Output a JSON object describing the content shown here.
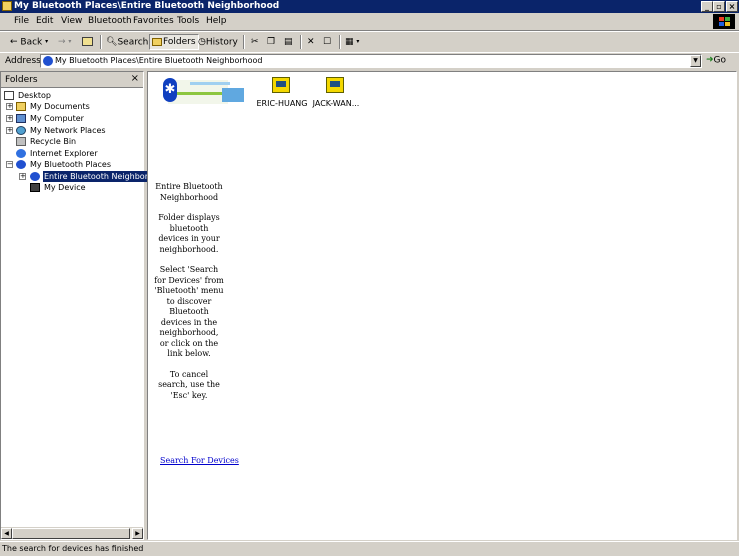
{
  "window": {
    "title": "My Bluetooth Places\\Entire Bluetooth Neighborhood"
  },
  "menu": {
    "items": [
      "File",
      "Edit",
      "View",
      "Bluetooth",
      "Favorites",
      "Tools",
      "Help"
    ]
  },
  "toolbar": {
    "back_label": "Back",
    "search_label": "Search",
    "folders_label": "Folders",
    "history_label": "History"
  },
  "address": {
    "label": "Address",
    "value": "My Bluetooth Places\\Entire Bluetooth Neighborhood",
    "go_label": "Go"
  },
  "folders": {
    "title": "Folders",
    "close_glyph": "×",
    "tree": [
      {
        "label": "Desktop",
        "icon": "desktop-icon"
      },
      {
        "label": "My Documents",
        "icon": "folder-icon"
      },
      {
        "label": "My Computer",
        "icon": "computer-icon"
      },
      {
        "label": "My Network Places",
        "icon": "network-icon"
      },
      {
        "label": "Recycle Bin",
        "icon": "recycle-bin-icon"
      },
      {
        "label": "Internet Explorer",
        "icon": "internet-explorer-icon"
      },
      {
        "label": "My Bluetooth Places",
        "icon": "bluetooth-icon"
      },
      {
        "label": "Entire Bluetooth Neighborhood",
        "icon": "bluetooth-neighborhood-icon",
        "selected": true
      },
      {
        "label": "My Device",
        "icon": "device-icon"
      }
    ]
  },
  "content": {
    "info_title": "Entire Bluetooth Neighborhood",
    "info_desc": "Folder displays bluetooth devices in your neighborhood.",
    "info_instructions": "Select 'Search for Devices' from 'Bluetooth' menu to discover Bluetooth devices in the neighborhood, or click on the link below.",
    "info_cancel": "To cancel search, use the 'Esc' key.",
    "search_link": "Search For Devices",
    "devices": [
      {
        "name": "ERIC-HUANG",
        "icon": "computer-device-icon"
      },
      {
        "name": "JACK-WAN...",
        "icon": "computer-device-icon"
      }
    ]
  },
  "status": {
    "text": "The search for devices has finished"
  },
  "colors": {
    "titlebar": "#0a246a",
    "chrome": "#d4d0c8",
    "selection": "#0a246a",
    "link": "#0000cc"
  }
}
